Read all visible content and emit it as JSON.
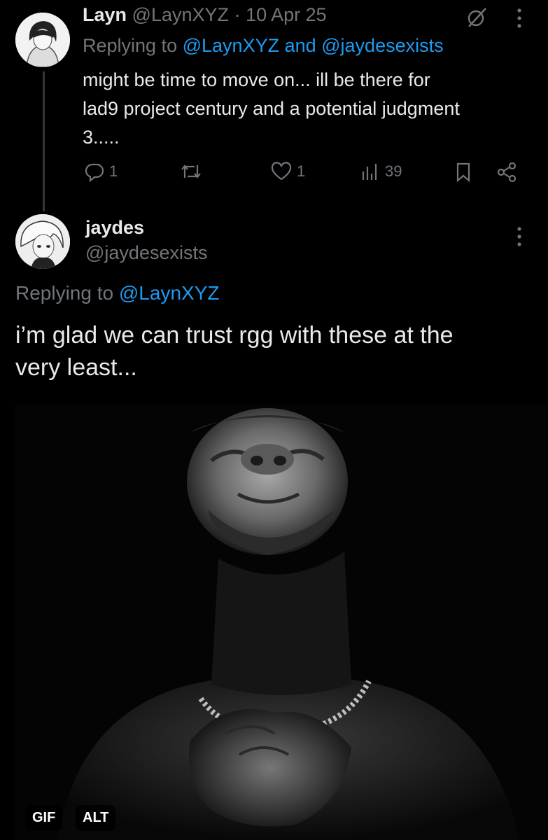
{
  "tweet1": {
    "author_name": "Layn",
    "handle": "@LaynXYZ",
    "separator": "·",
    "date": "10 Apr 25",
    "replying_prefix": "Replying to",
    "replying_users": "@LaynXYZ and @jaydesexists",
    "text_line1": "might be time to move on... ill be there for",
    "text_line2": "lad9 project century and a potential judgment",
    "text_line3": "3.....",
    "reply_count": "1",
    "like_count": "1",
    "view_count": "39"
  },
  "tweet2": {
    "author_name": "jaydes",
    "handle": "@jaydesexists",
    "replying_prefix": "Replying to",
    "replying_user": "@LaynXYZ",
    "text_line1": "i’m glad we can trust rgg with these at the",
    "text_line2": "very least...",
    "media": {
      "gif_label": "GIF",
      "alt_label": "ALT"
    }
  },
  "colors": {
    "background": "#000000",
    "text": "#e7e9ea",
    "muted": "#71767b",
    "link": "#1d9bf0"
  },
  "icons": [
    "avatar-layn",
    "grok-icon",
    "more-icon",
    "reply-icon",
    "retweet-icon",
    "like-icon",
    "views-icon",
    "bookmark-icon",
    "share-icon",
    "avatar-jaydes"
  ]
}
